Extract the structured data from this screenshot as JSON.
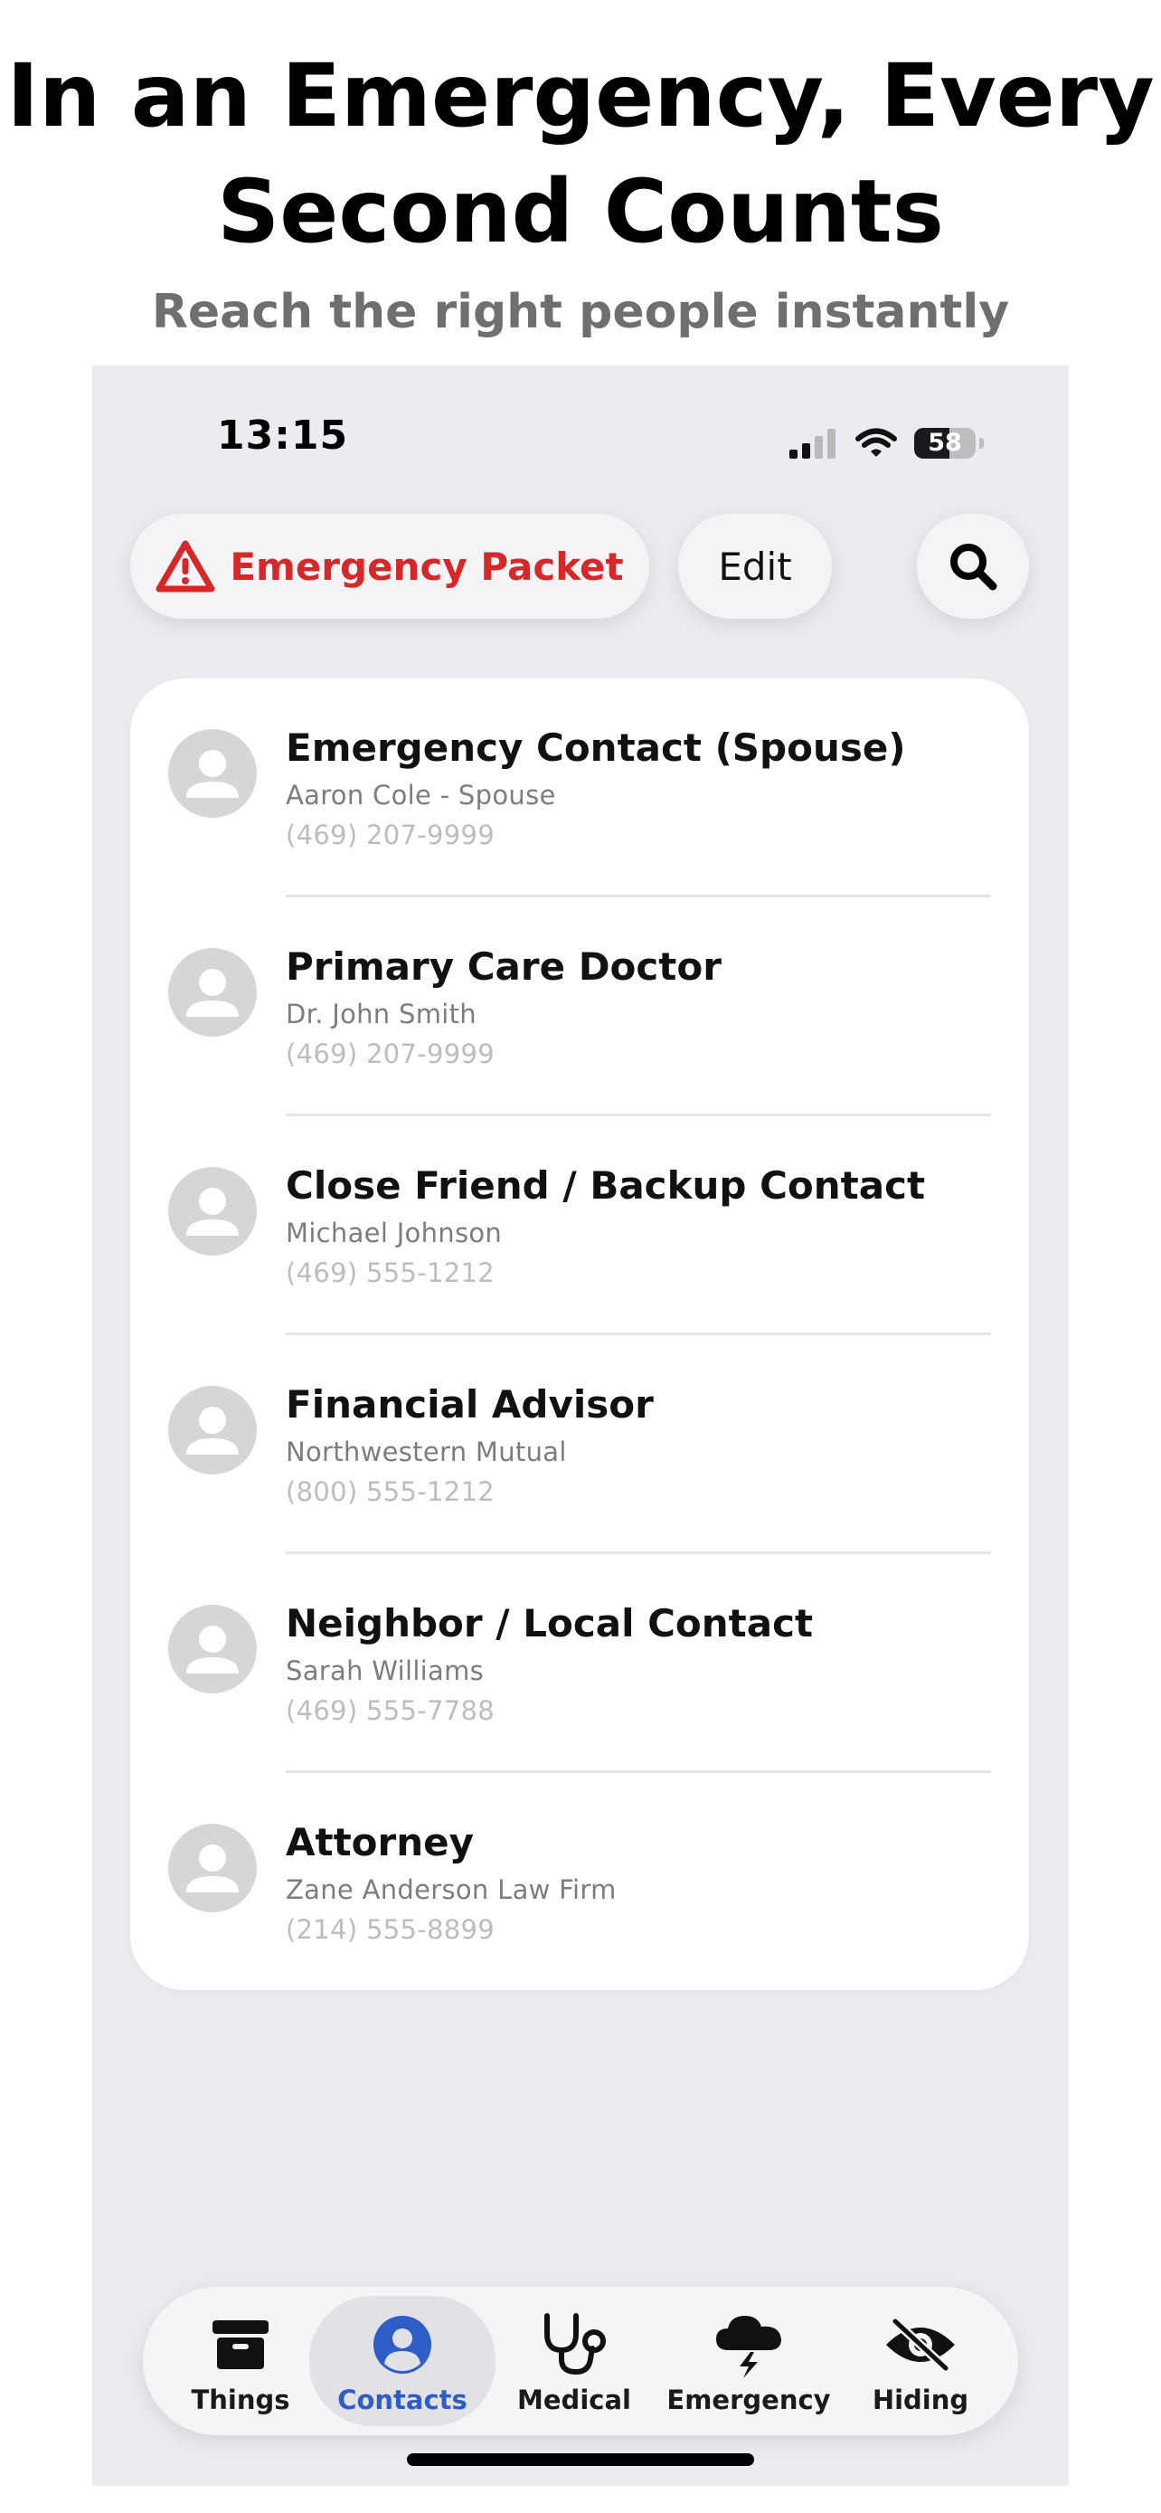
{
  "marketing": {
    "headline_line1": "In an Emergency, Every",
    "headline_line2": "Second Counts",
    "subhead": "Reach the right people instantly"
  },
  "status_bar": {
    "time": "13:15",
    "battery_percent": "58",
    "icons": [
      "cellular-signal-icon",
      "wifi-icon",
      "battery-icon"
    ]
  },
  "toolbar": {
    "emergency_label": "Emergency Packet",
    "edit_label": "Edit",
    "accent_color": "#d62828"
  },
  "contacts": [
    {
      "title": "Emergency Contact (Spouse)",
      "subtitle": "Aaron Cole - Spouse",
      "phone": "(469) 207-9999"
    },
    {
      "title": "Primary Care Doctor",
      "subtitle": "Dr. John Smith",
      "phone": "(469) 207-9999"
    },
    {
      "title": "Close Friend / Backup Contact",
      "subtitle": "Michael Johnson",
      "phone": "(469) 555-1212"
    },
    {
      "title": "Financial Advisor",
      "subtitle": "Northwestern Mutual",
      "phone": "(800) 555-1212"
    },
    {
      "title": "Neighbor / Local Contact",
      "subtitle": "Sarah Williams",
      "phone": "(469) 555-7788"
    },
    {
      "title": "Attorney",
      "subtitle": "Zane Anderson Law Firm",
      "phone": "(214) 555-8899"
    }
  ],
  "tabbar": {
    "active_color": "#2f5dc8",
    "items": [
      {
        "label": "Things",
        "icon": "archive-box-icon",
        "active": false
      },
      {
        "label": "Contacts",
        "icon": "person-circle-icon",
        "active": true
      },
      {
        "label": "Medical",
        "icon": "stethoscope-icon",
        "active": false
      },
      {
        "label": "Emergency",
        "icon": "storm-cloud-icon",
        "active": false
      },
      {
        "label": "Hiding",
        "icon": "eye-slash-icon",
        "active": false
      }
    ]
  }
}
